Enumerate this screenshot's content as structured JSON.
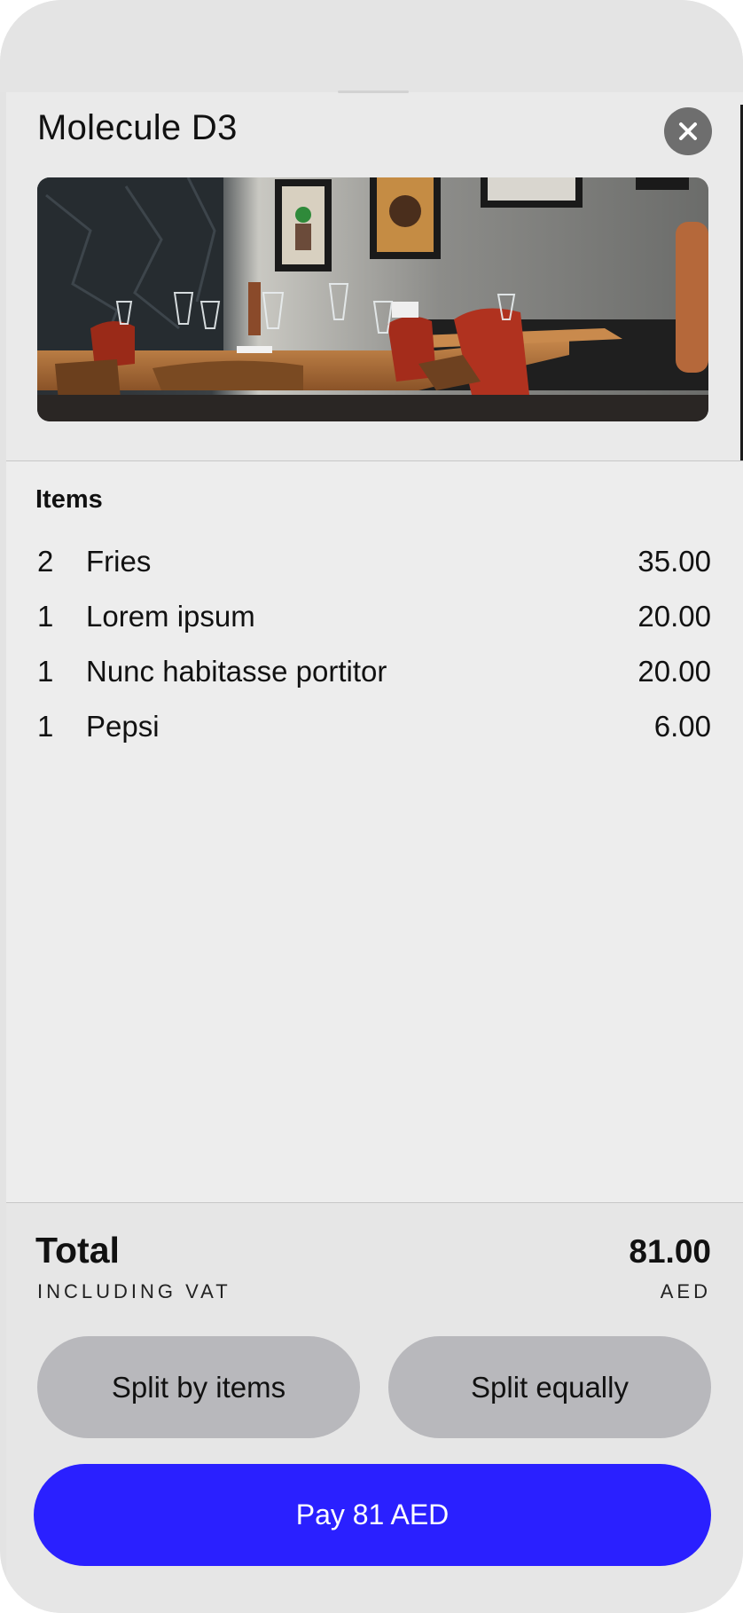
{
  "restaurant": {
    "name": "Molecule D3"
  },
  "header": {
    "close_icon": "close-icon"
  },
  "items": {
    "heading": "Items",
    "rows": [
      {
        "qty": "2",
        "name": "Fries",
        "price": "35.00"
      },
      {
        "qty": "1",
        "name": "Lorem ipsum",
        "price": "20.00"
      },
      {
        "qty": "1",
        "name": "Nunc habitasse portitor",
        "price": "20.00"
      },
      {
        "qty": "1",
        "name": "Pepsi",
        "price": "6.00"
      }
    ]
  },
  "total": {
    "label": "Total",
    "sublabel": "INCLUDING VAT",
    "amount": "81.00",
    "currency": "AED"
  },
  "actions": {
    "split_items": "Split by items",
    "split_equally": "Split equally",
    "pay": "Pay 81 AED"
  },
  "colors": {
    "pay_button": "#2a20ff",
    "split_button": "#b8b8bc",
    "close_button": "#6e6e6e"
  }
}
